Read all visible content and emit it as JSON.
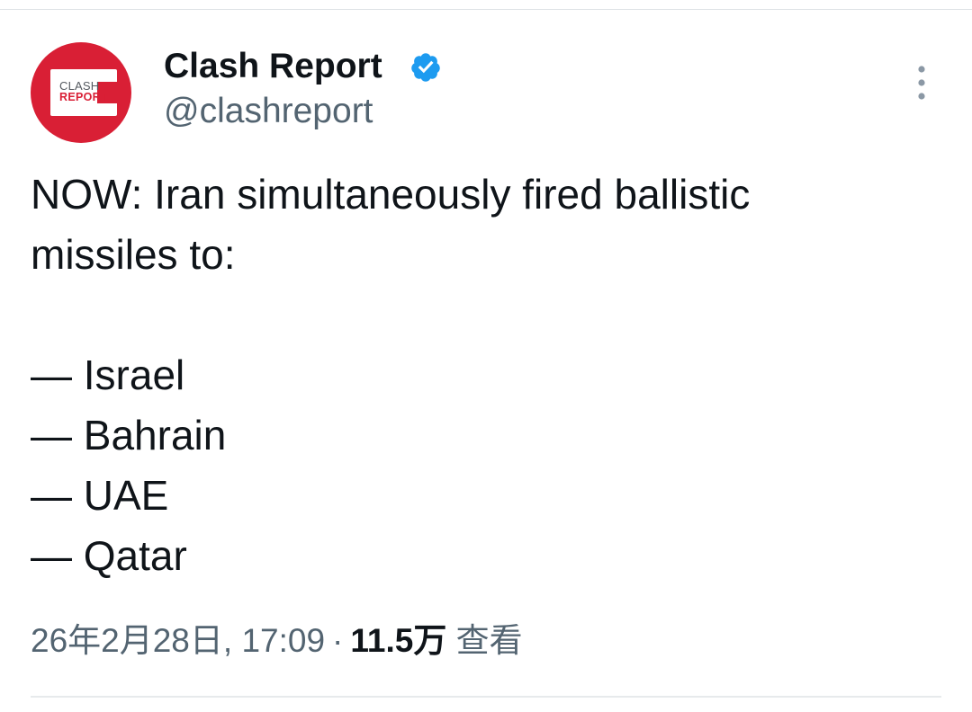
{
  "author": {
    "avatar_logo": {
      "line1": "CLASH",
      "line2": "REPORT"
    },
    "display_name": "Clash Report",
    "handle": "@clashreport",
    "verified": true
  },
  "tweet": {
    "text": "NOW: Iran simultaneously fired ballistic\nmissiles to:\n\n— Israel\n— Bahrain\n— UAE\n— Qatar"
  },
  "meta": {
    "timestamp": "26年2月28日, 17:09",
    "separator": "·",
    "views_count": "11.5万",
    "views_label": "查看"
  },
  "icons": {
    "verified": "verified-badge-icon",
    "more": "more-vertical-icon"
  },
  "colors": {
    "brand_red": "#d91f35",
    "verified_blue": "#1d9bf0",
    "secondary_text": "#536471",
    "primary_text": "#0f1419"
  }
}
